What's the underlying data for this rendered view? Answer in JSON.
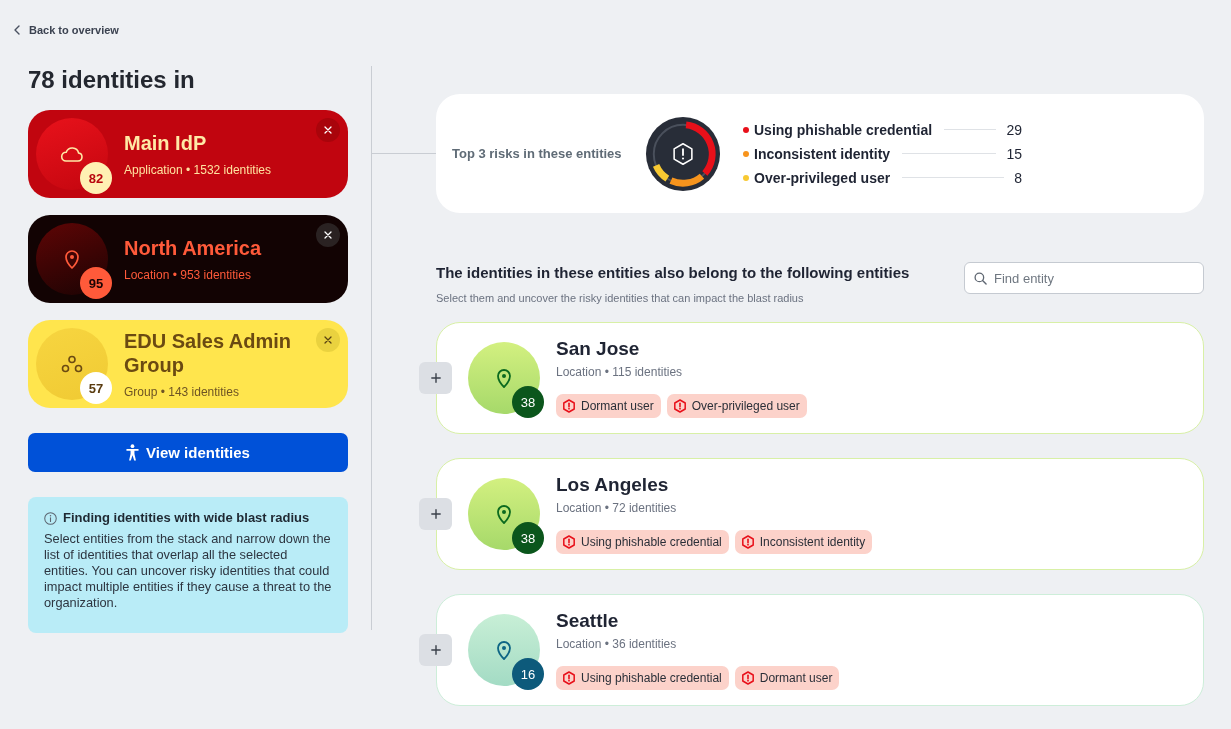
{
  "back_link": {
    "label": "Back to overview"
  },
  "selection": {
    "heading": "78 identities in",
    "entities": [
      {
        "kind": "application",
        "name": "Main IdP",
        "details": "Application • 1532 identities",
        "score": "82",
        "color": "#c1050f"
      },
      {
        "kind": "location",
        "name": "North America",
        "details": "Location • 953 identities",
        "score": "95",
        "color": "#120303"
      },
      {
        "kind": "group",
        "name": "EDU Sales Admin Group",
        "details": "Group • 143 identities",
        "score": "57",
        "color": "#ffe54d"
      }
    ],
    "view_button": {
      "label": "View identities"
    },
    "info": {
      "title": "Finding identities with wide blast radius",
      "text": "Select entities from the stack and narrow down the list of identities that overlap all the selected entities. You can uncover risky identities that could impact multiple entities if they cause a threat to the organization."
    }
  },
  "risk_summary": {
    "title": "Top 3 risks in these entities",
    "chart_data": {
      "type": "donut",
      "values": [
        55.8,
        28.8,
        15.4
      ]
    },
    "risks": [
      {
        "label": "Using phishable credential",
        "count": "29",
        "color": "#e8101a"
      },
      {
        "label": "Inconsistent identity",
        "count": "15",
        "color": "#f7941d"
      },
      {
        "label": "Over-privileged user",
        "count": "8",
        "color": "#f8c932"
      }
    ]
  },
  "related": {
    "heading": "The identities in these entities also belong to the following entities",
    "subheading": "Select them and uncover the risky identities that can impact the blast radius",
    "search": {
      "placeholder": "Find entity"
    },
    "entities": [
      {
        "kind": "location",
        "name": "San Jose",
        "details": "Location • 115 identities",
        "score": "38",
        "color": "#0b561c",
        "risks": [
          "Dormant user",
          "Over-privileged user"
        ]
      },
      {
        "kind": "location",
        "name": "Los Angeles",
        "details": "Location • 72 identities",
        "score": "38",
        "color": "#0b561c",
        "risks": [
          "Using phishable credential",
          "Inconsistent identity"
        ]
      },
      {
        "kind": "location",
        "name": "Seattle",
        "details": "Location • 36 identities",
        "score": "16",
        "color": "#0d5a7b",
        "risks": [
          "Using phishable credential",
          "Dormant user"
        ]
      }
    ]
  }
}
